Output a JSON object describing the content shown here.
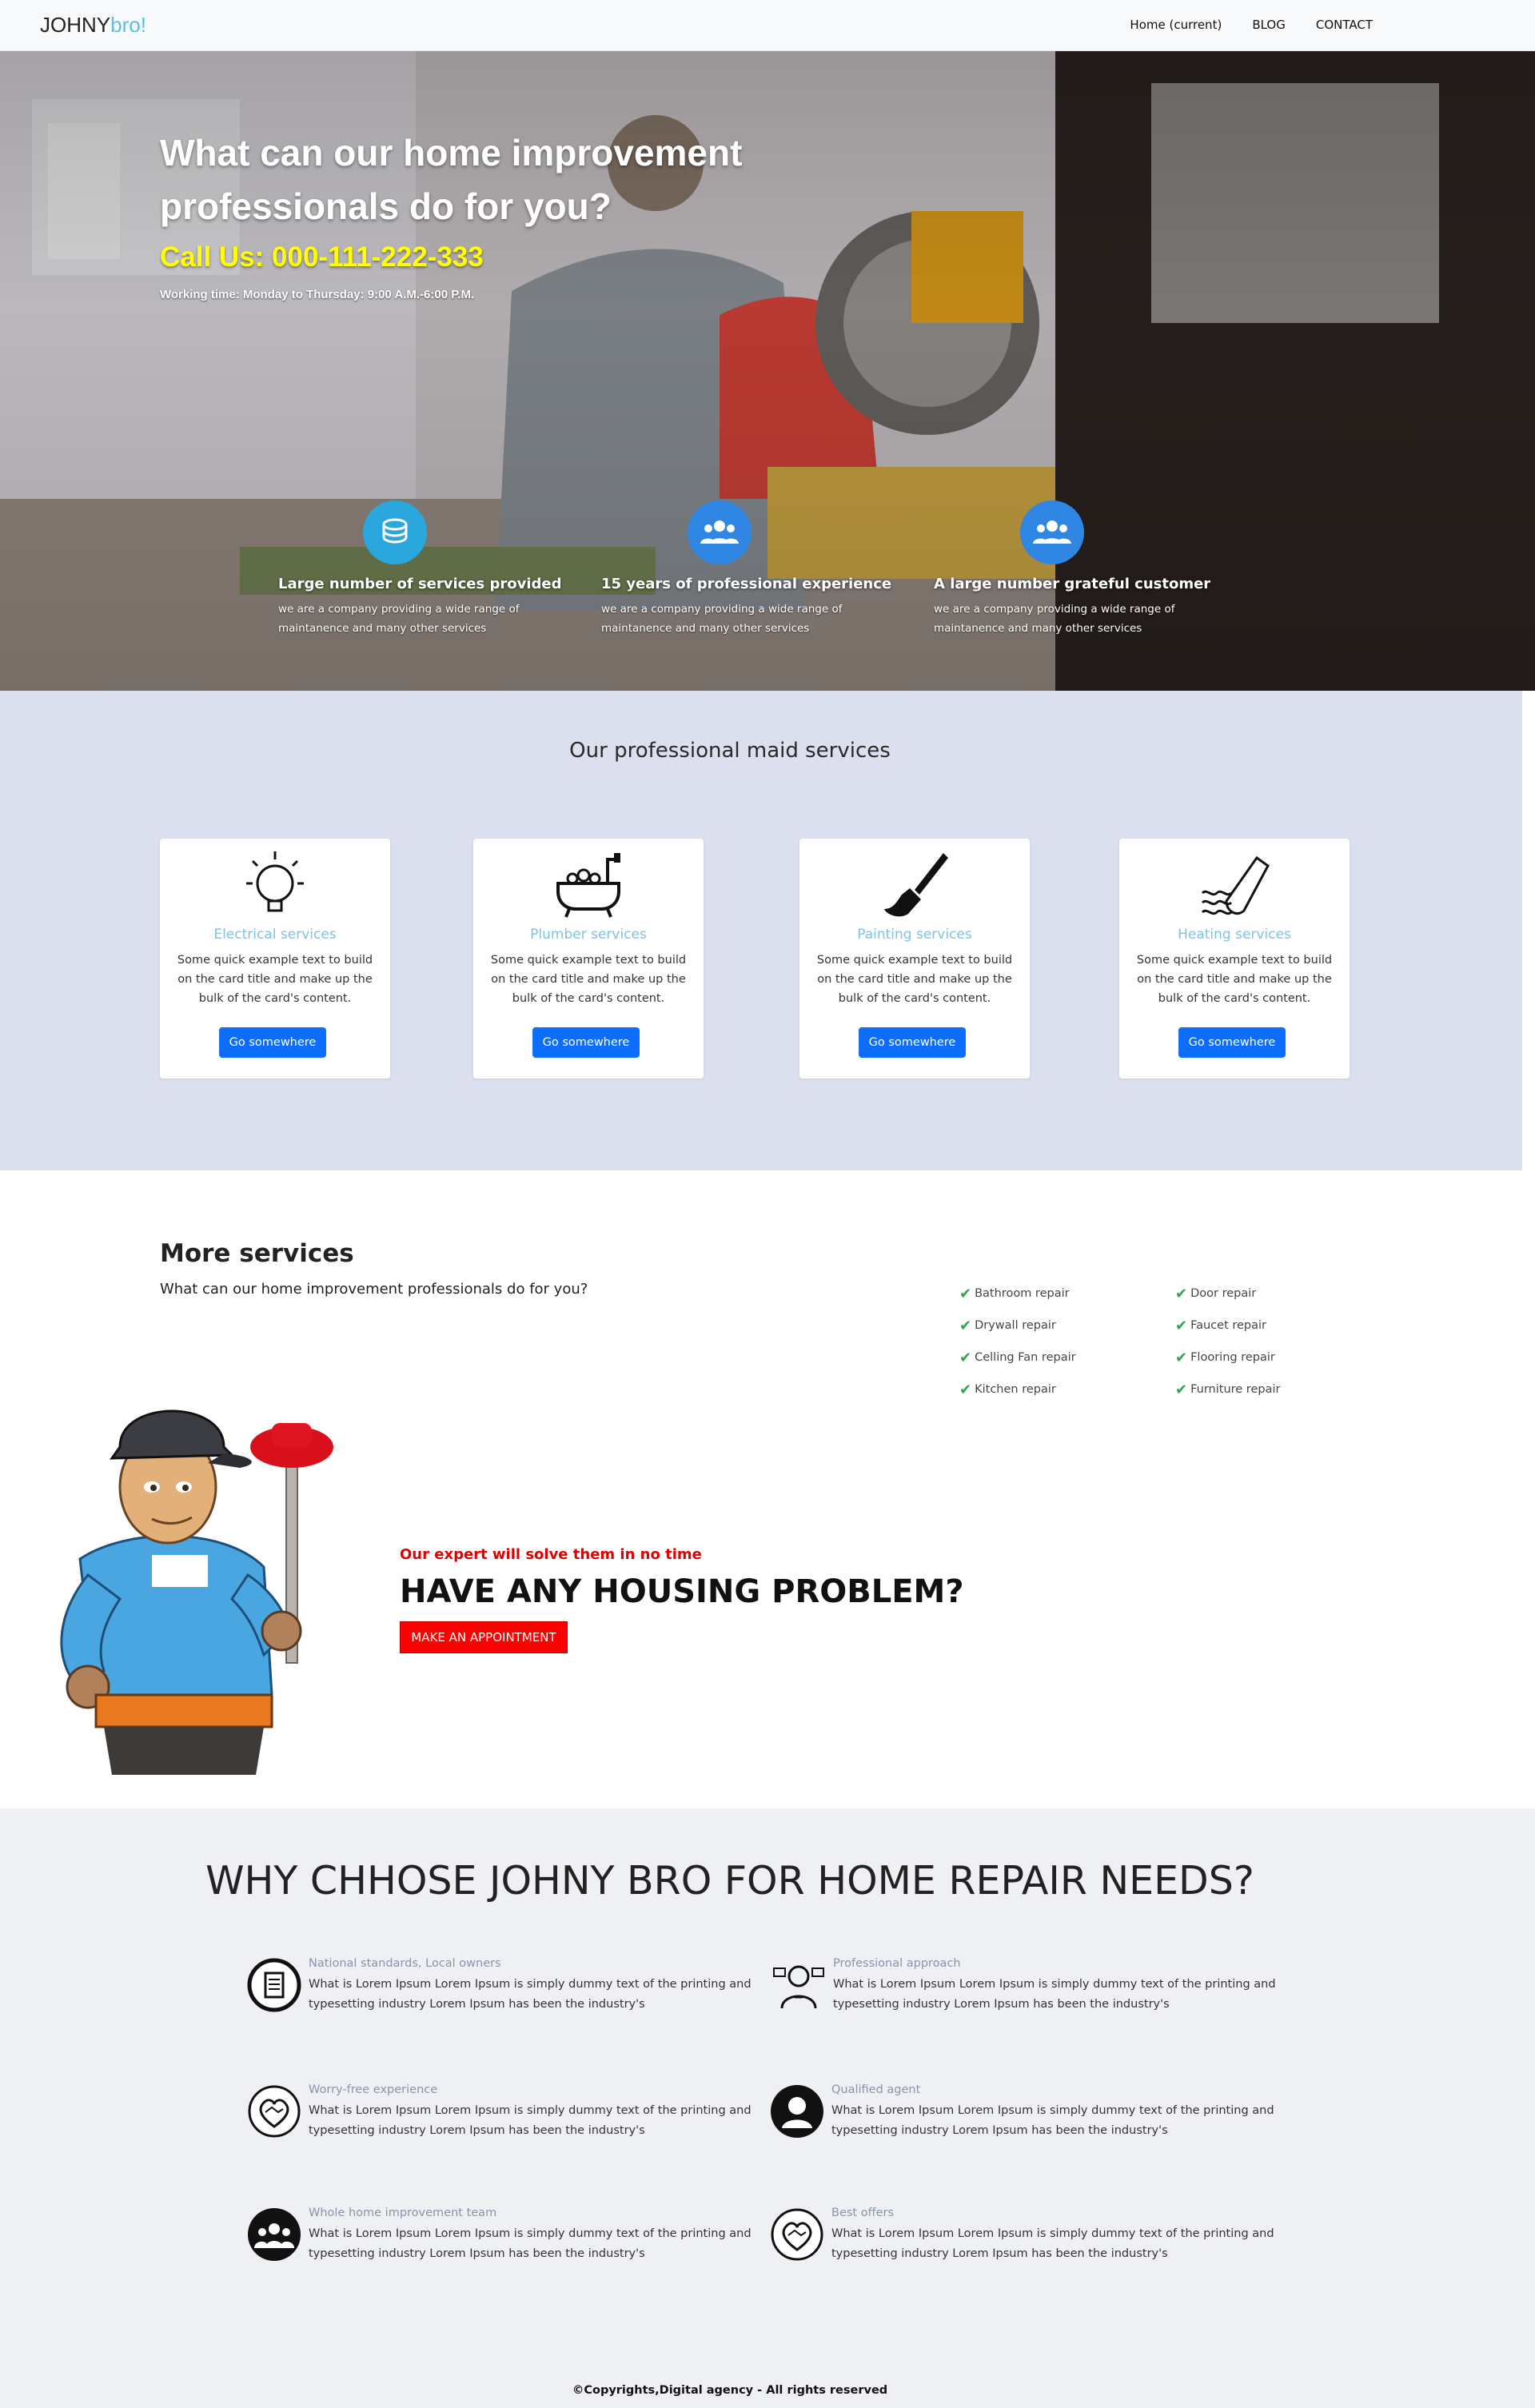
{
  "navbar": {
    "brand_main": "JOHNY",
    "brand_accent": "bro!",
    "links": [
      "Home (current)",
      "BLOG",
      "CONTACT"
    ]
  },
  "hero": {
    "title": "What can our home improvement professionals do for you?",
    "phone": "Call Us: 000-111-222-333",
    "hours": "Working time: Monday to Thursday: 9:00 A.M.-6:00 P.M.",
    "features": [
      {
        "icon": "coins-icon",
        "color": "#2aa7dc",
        "title": "Large number of services provided",
        "text": "we are a company providing a wide range of maintanence and many other services"
      },
      {
        "icon": "users-icon",
        "color": "#2f87e3",
        "title": "15 years of professional experience",
        "text": "we are a company providing a wide range of maintanence and many other services"
      },
      {
        "icon": "users-icon",
        "color": "#2f87e3",
        "title": "A large number grateful customer",
        "text": "we are a company providing a wide range of maintanence and many other services"
      }
    ]
  },
  "maid": {
    "title": "Our professional maid services",
    "cards": [
      {
        "icon": "lightbulb-icon",
        "title": "Electrical services",
        "text": "Some quick example text to build on the card title and make up the bulk of the card's content.",
        "button": "Go somewhere"
      },
      {
        "icon": "bathtub-icon",
        "title": "Plumber services",
        "text": "Some quick example text to build on the card title and make up the bulk of the card's content.",
        "button": "Go somewhere"
      },
      {
        "icon": "paintbrush-icon",
        "title": "Painting services",
        "text": "Some quick example text to build on the card title and make up the bulk of the card's content.",
        "button": "Go somewhere"
      },
      {
        "icon": "heating-icon",
        "title": "Heating services",
        "text": "Some quick example text to build on the card title and make up the bulk of the card's content.",
        "button": "Go somewhere"
      }
    ]
  },
  "more": {
    "title": "More services",
    "subtitle": "What can our home improvement professionals do for you?",
    "list_left": [
      "Bathroom repair",
      "Drywall repair",
      "Celling Fan repair",
      "Kitchen repair"
    ],
    "list_right": [
      "Door repair",
      "Faucet repair",
      "Flooring repair",
      "Furniture repair"
    ]
  },
  "problem": {
    "expert": "Our expert will solve them in no time",
    "headline": "HAVE ANY HOUSING PROBLEM?",
    "button": "MAKE AN APPOINTMENT"
  },
  "why": {
    "title": "WHY CHHOSE JOHNY BRO FOR HOME REPAIR NEEDS?",
    "items": [
      {
        "icon": "document-icon",
        "title": "National standards, Local owners",
        "text": "What is Lorem Ipsum Lorem Ipsum is simply dummy text of the printing and typesetting industry Lorem Ipsum has been the industry's"
      },
      {
        "icon": "professional-icon",
        "title": "Professional approach",
        "text": "What is Lorem Ipsum Lorem Ipsum is simply dummy text of the printing and typesetting industry Lorem Ipsum has been the industry's"
      },
      {
        "icon": "handshake-icon",
        "title": "Worry-free experience",
        "text": "What is Lorem Ipsum Lorem Ipsum is simply dummy text of the printing and typesetting industry Lorem Ipsum has been the industry's"
      },
      {
        "icon": "agent-icon",
        "title": "Qualified agent",
        "text": "What is Lorem Ipsum Lorem Ipsum is simply dummy text of the printing and typesetting industry Lorem Ipsum has been the industry's"
      },
      {
        "icon": "team-icon",
        "title": "Whole home improvement team",
        "text": "What is Lorem Ipsum Lorem Ipsum is simply dummy text of the printing and typesetting industry Lorem Ipsum has been the industry's"
      },
      {
        "icon": "handshake-heart-icon",
        "title": "Best offers",
        "text": "What is Lorem Ipsum Lorem Ipsum is simply dummy text of the printing and typesetting industry Lorem Ipsum has been the industry's"
      }
    ]
  },
  "footer": {
    "text": "©Copyrights,Digital agency - All rights reserved"
  }
}
